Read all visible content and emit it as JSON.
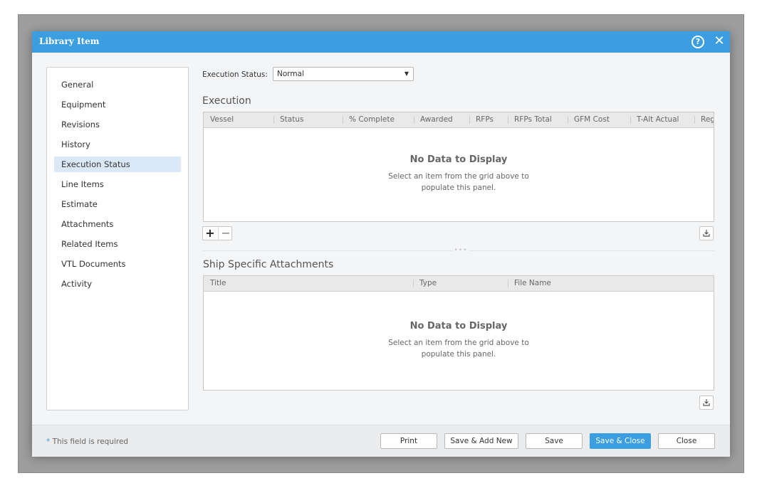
{
  "dialog": {
    "title": "Library Item"
  },
  "icons": {
    "help": "help-circle-icon",
    "close": "close-icon",
    "export": "export-icon"
  },
  "nav": {
    "items": [
      {
        "label": "General"
      },
      {
        "label": "Equipment"
      },
      {
        "label": "Revisions"
      },
      {
        "label": "History"
      },
      {
        "label": "Execution Status",
        "active": true
      },
      {
        "label": "Line Items"
      },
      {
        "label": "Estimate"
      },
      {
        "label": "Attachments"
      },
      {
        "label": "Related Items"
      },
      {
        "label": "VTL Documents"
      },
      {
        "label": "Activity"
      }
    ]
  },
  "execution_status": {
    "label": "Execution Status:",
    "value": "Normal"
  },
  "execution": {
    "title": "Execution",
    "columns": [
      "Vessel",
      "Status",
      "% Complete",
      "Awarded",
      "RFPs",
      "RFPs Total",
      "GFM Cost",
      "T-Alt Actual",
      "Reg"
    ],
    "empty_title": "No Data to Display",
    "empty_line1": "Select an item from the grid above to",
    "empty_line2": "populate this panel.",
    "add_symbol": "+",
    "remove_symbol": "−"
  },
  "attachments": {
    "title": "Ship Specific Attachments",
    "columns": [
      "Title",
      "Type",
      "File Name"
    ],
    "empty_title": "No Data to Display",
    "empty_line1": "Select an item from the grid above to",
    "empty_line2": "populate this panel."
  },
  "footer": {
    "required_star": "*",
    "required_note": "This field is required",
    "buttons": {
      "print": "Print",
      "save_add_new": "Save & Add New",
      "save": "Save",
      "save_close": "Save & Close",
      "close": "Close"
    }
  },
  "colors": {
    "accent": "#3a9ee0",
    "active_nav": "#dbe8f7"
  }
}
